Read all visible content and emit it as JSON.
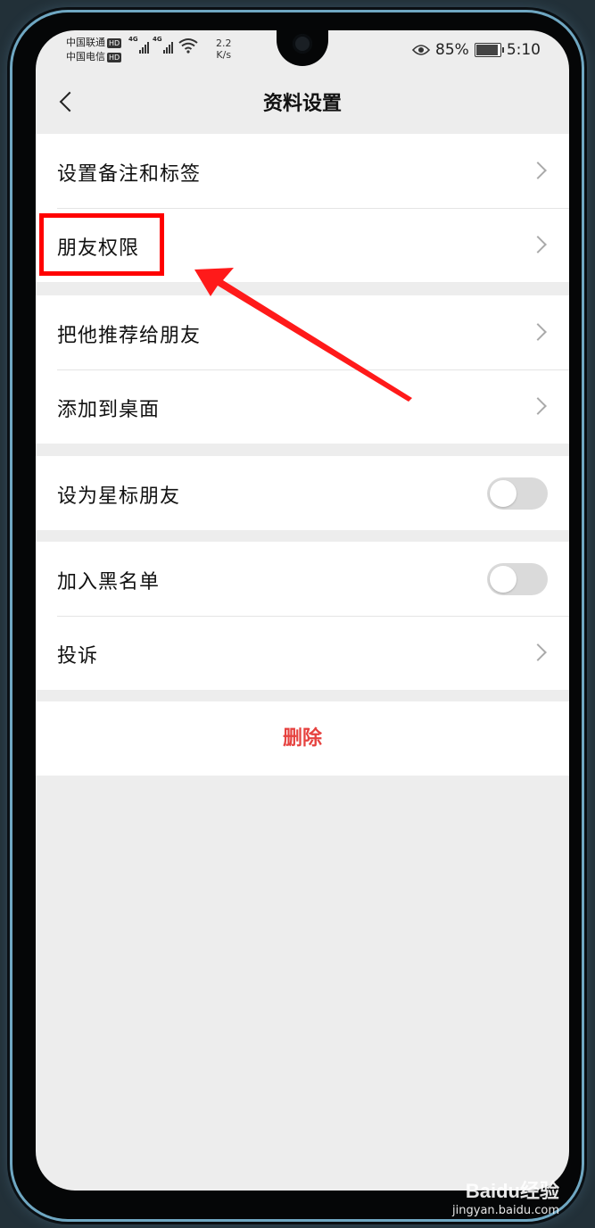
{
  "status_bar": {
    "carrier1": "中国联通",
    "carrier2": "中国电信",
    "hd": "HD",
    "net_type": "4G",
    "speed_value": "2.2",
    "speed_unit": "K/s",
    "battery_percent": "85%",
    "time": "5:10"
  },
  "header": {
    "title": "资料设置"
  },
  "settings": {
    "group1": [
      {
        "label": "设置备注和标签"
      },
      {
        "label": "朋友权限"
      }
    ],
    "group2": [
      {
        "label": "把他推荐给朋友"
      },
      {
        "label": "添加到桌面"
      }
    ],
    "group3": [
      {
        "label": "设为星标朋友",
        "toggle": false
      }
    ],
    "group4": [
      {
        "label": "加入黑名单",
        "toggle": false
      },
      {
        "label": "投诉"
      }
    ],
    "delete_label": "删除"
  },
  "watermark": {
    "logo": "Baidu经验",
    "site": "jingyan.baidu.com"
  },
  "colors": {
    "delete_red": "#e64340",
    "highlight_red": "#ff0000"
  }
}
